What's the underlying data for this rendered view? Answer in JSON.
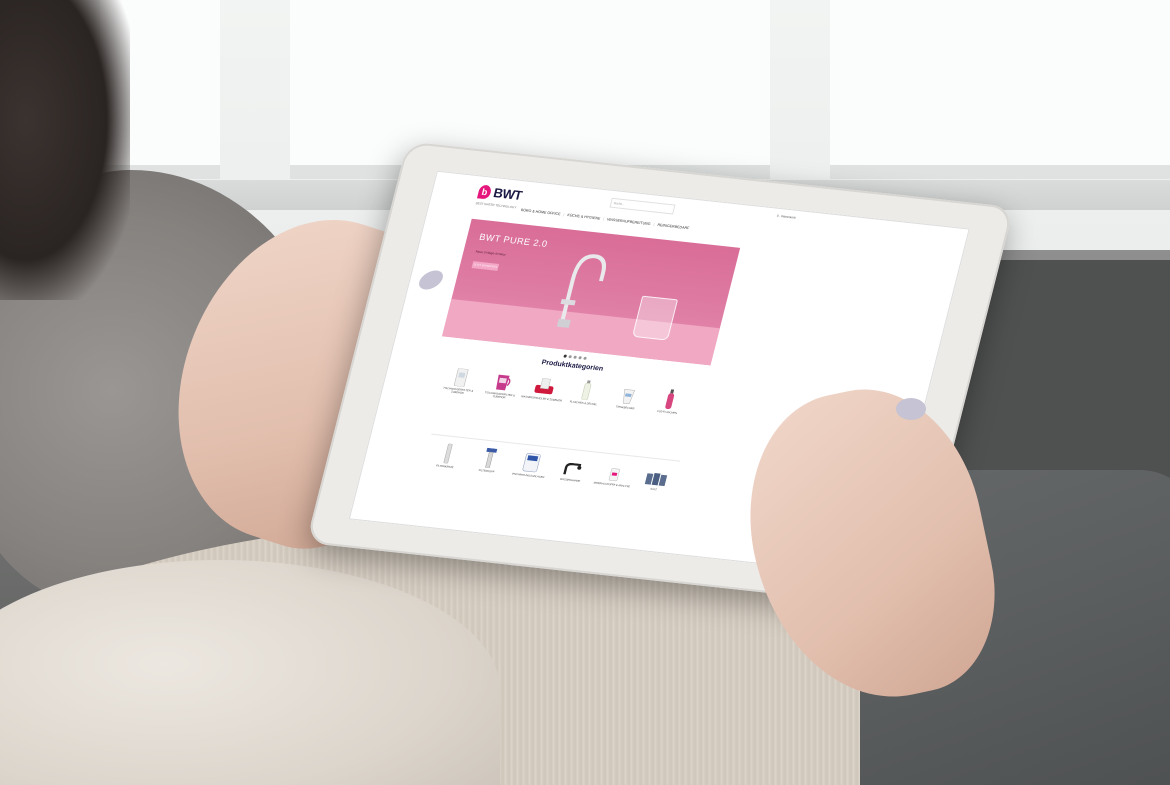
{
  "site": {
    "brand": "BWT",
    "brand_tagline": "BEST WATER TECHNOLOGY",
    "search_placeholder": "Suche...",
    "cart_label": "0 - Warenkorb"
  },
  "nav": {
    "items": [
      "BÜRO & HOME OFFICE",
      "KÜCHE & HYGIENE",
      "WASSERAUFBEREITUNG",
      "REINIGERBEDARF"
    ]
  },
  "hero": {
    "title": "BWT PURE 2.0",
    "subtitle": "Neue 3-Wege-Armatur",
    "button_label": "JETZT ENTDECKEN"
  },
  "categories": {
    "title": "Produktkategorien",
    "row1": [
      {
        "label": "TISCHWASSERFILTER & ZUBEHÖR",
        "icon": "dispenser-icon"
      },
      {
        "label": "TISCHWASSERFILTER & ZUBEHÖR",
        "icon": "filter-jug-icon"
      },
      {
        "label": "WASSERSPRUDLER & ZUBEHÖR",
        "icon": "sparkler-icon"
      },
      {
        "label": "FLASCHEN & DECKEL",
        "icon": "bottle-icon"
      },
      {
        "label": "TRINKBECHER",
        "icon": "cup-icon"
      },
      {
        "label": "CO2-FLASCHEN",
        "icon": "co2-icon"
      }
    ],
    "row2": [
      {
        "label": "FILTERKERZE",
        "icon": "cartridge-icon"
      },
      {
        "label": "FILTERKOPF",
        "icon": "filter-head-icon"
      },
      {
        "label": "ENTHÄRTUNGSANLAGEN",
        "icon": "softener-icon"
      },
      {
        "label": "WASSERHÄHNE",
        "icon": "tap-icon"
      },
      {
        "label": "MINERALSTOFFE & ANALYSE",
        "icon": "minerals-icon"
      },
      {
        "label": "SALZ",
        "icon": "salt-icon"
      }
    ]
  },
  "colors": {
    "brand_pink": "#e6177c",
    "brand_navy": "#1b1a44",
    "hero_pink": "#dc7aa2"
  }
}
